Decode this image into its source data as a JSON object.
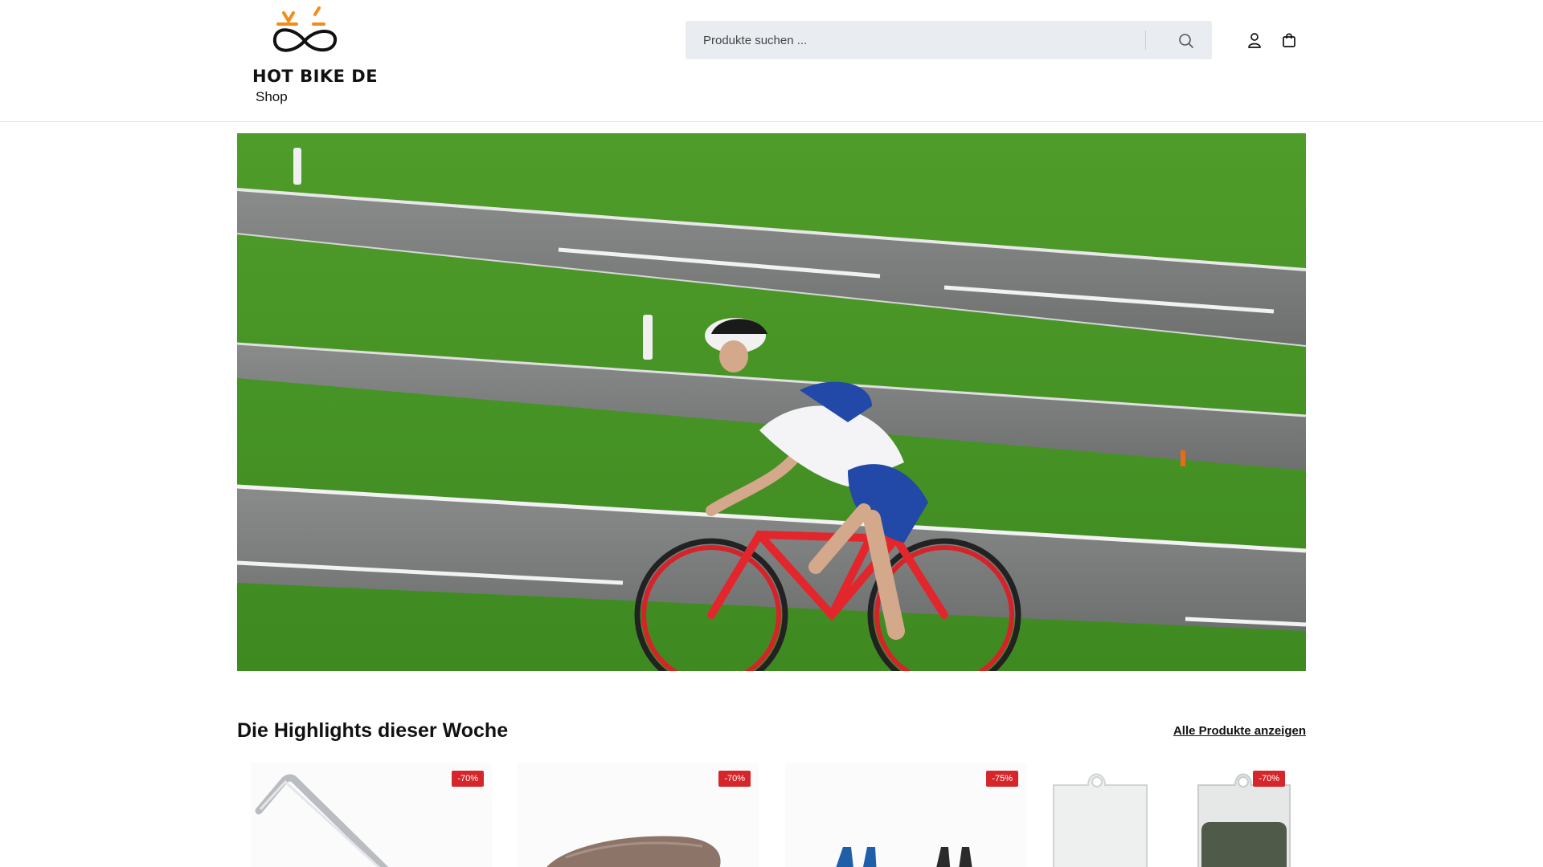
{
  "brand": {
    "name": "HOT BIKE DE"
  },
  "nav": {
    "items": [
      {
        "label": "Shop"
      }
    ]
  },
  "search": {
    "placeholder": "Produkte suchen ..."
  },
  "icons": {
    "search": "search-icon",
    "account": "user-icon",
    "cart": "shopping-bag-icon"
  },
  "colors": {
    "accent_orange": "#f28c1b",
    "badge_red": "#d7262b",
    "search_bg": "#e9edf2"
  },
  "highlights": {
    "title": "Die Highlights dieser Woche",
    "view_all_label": "Alle Produkte anzeigen",
    "products": [
      {
        "discount": "-70%"
      },
      {
        "discount": "-70%"
      },
      {
        "discount": "-75%"
      },
      {
        "discount": "-70%"
      }
    ]
  }
}
